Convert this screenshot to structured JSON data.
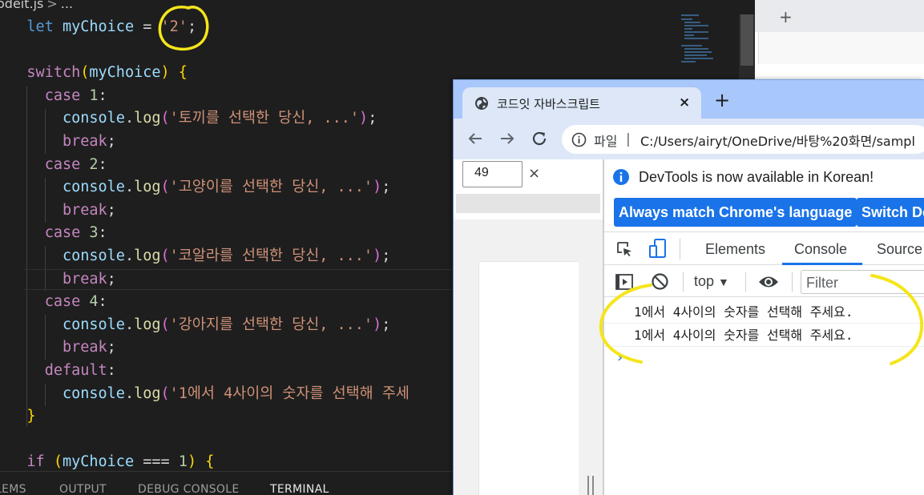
{
  "editor": {
    "breadcrumb": {
      "file": "odeit.js",
      "sep": ">",
      "rest": "..."
    },
    "lines": {
      "l1": {
        "let": "let",
        "name": "myChoice",
        "eq": " = ",
        "value": "'2'",
        "semi": ";"
      },
      "l3": {
        "switch": "switch",
        "arg": "myChoice"
      },
      "case1": {
        "kw": "case",
        "num": "1"
      },
      "log1": "'토끼를 선택한 당신, ...'",
      "case2": {
        "kw": "case",
        "num": "2"
      },
      "log2": "'고양이를 선택한 당신, ...'",
      "case3": {
        "kw": "case",
        "num": "3"
      },
      "log3": "'코알라를 선택한 당신, ...'",
      "case4": {
        "kw": "case",
        "num": "4"
      },
      "log4": "'강아지를 선택한 당신, ...'",
      "default": "default",
      "log5": "'1에서 4사이의 숫자를 선택해 주세",
      "console": "console",
      "log": "log",
      "break": "break",
      "if": {
        "kw": "if",
        "arg": "myChoice",
        "op": " === ",
        "num": "1"
      }
    },
    "panel_tabs": [
      "LEMS",
      "OUTPUT",
      "DEBUG CONSOLE",
      "TERMINAL"
    ],
    "active_panel_tab": "TERMINAL"
  },
  "background_browser": {
    "new_tab": "+"
  },
  "chrome": {
    "tab_title": "코드잇 자바스크립트",
    "tab_close": "×",
    "new_tab": "+",
    "omnibox": {
      "label": "파일",
      "sep": "|",
      "url": "C:/Users/airyt/OneDrive/바탕%20화면/sampl"
    },
    "find": {
      "value": "49",
      "close": "×"
    },
    "devtools": {
      "info_text": "DevTools is now available in Korean!",
      "btn_match": "Always match Chrome's language",
      "btn_switch": "Switch De",
      "tabs": [
        "Elements",
        "Console",
        "Source"
      ],
      "active_tab": "Console",
      "context": "top",
      "context_arrow": "▼",
      "filter_placeholder": "Filter",
      "logs": [
        "1에서 4사이의 숫자를 선택해 주세요.",
        "1에서 4사이의 숫자를 선택해 주세요."
      ],
      "prompt": "›"
    }
  },
  "colors": {
    "highlight_annotation": "#f5e51b",
    "devtools_accent": "#1a73e8",
    "editor_bg": "#1e1e1e",
    "tabstrip": "#a8c7fa"
  },
  "icons": [
    "globe-icon",
    "back-arrow-icon",
    "forward-arrow-icon",
    "reload-icon",
    "info-icon",
    "inspect-icon",
    "device-toolbar-icon",
    "sidebar-toggle-icon",
    "clear-console-icon",
    "eye-icon"
  ]
}
